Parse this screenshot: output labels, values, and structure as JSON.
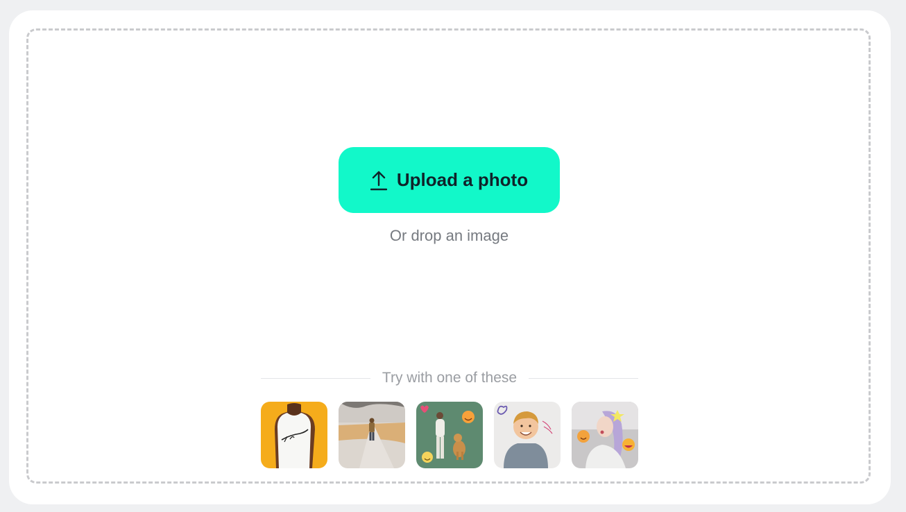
{
  "upload": {
    "button_label": "Upload a photo",
    "icon": "upload-arrow-icon",
    "hint": "Or drop an image",
    "accent_color": "#12f8c9"
  },
  "samples": {
    "heading": "Try with one of these",
    "items": [
      {
        "label": "Man in white InsMind t-shirt on orange background",
        "text_on_image": "InsMind"
      },
      {
        "label": "Person walking on a misty road"
      },
      {
        "label": "Woman with golden retriever and emoji stickers"
      },
      {
        "label": "Smiling child in grey hoodie with doodles"
      },
      {
        "label": "Woman with lavender hair and emoji stickers"
      }
    ]
  }
}
